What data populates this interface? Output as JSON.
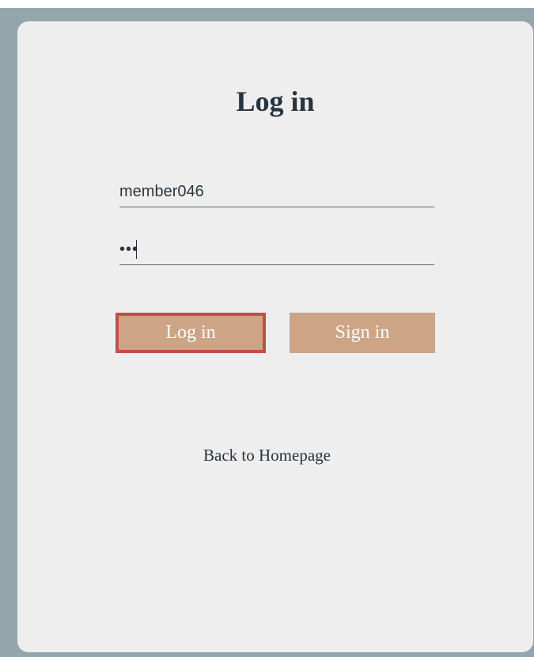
{
  "page": {
    "title": "Log in"
  },
  "form": {
    "username_value": "member046",
    "password_value": "•••"
  },
  "buttons": {
    "login_label": "Log in",
    "signin_label": "Sign in"
  },
  "links": {
    "back_label": "Back to Homepage"
  },
  "colors": {
    "frame_background": "#93a6ab",
    "card_background": "#efeeee",
    "button_fill": "#cda586",
    "focus_outline": "#c44d4b",
    "text_dark": "#243441"
  }
}
